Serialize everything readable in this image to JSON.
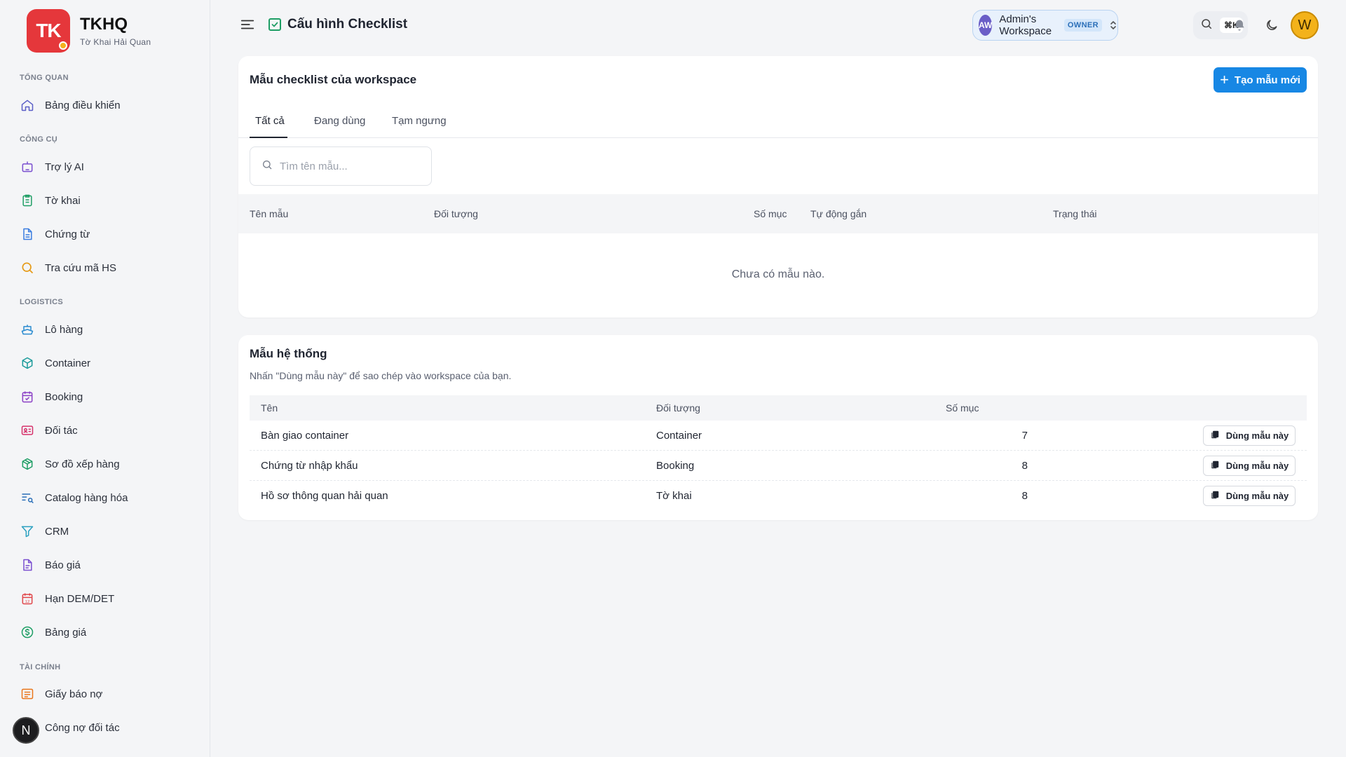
{
  "brand": {
    "logo_text": "TK",
    "name": "TKHQ",
    "subtitle": "Tờ Khai Hải Quan"
  },
  "sidebar": {
    "sections": [
      {
        "label": "TỔNG QUAN"
      },
      {
        "label": "CÔNG CỤ"
      },
      {
        "label": "LOGISTICS"
      },
      {
        "label": "TÀI CHÍNH"
      }
    ],
    "items": [
      {
        "label": "Bảng điều khiển",
        "icon": "home-icon"
      },
      {
        "label": "Trợ lý AI",
        "icon": "robot-icon"
      },
      {
        "label": "Tờ khai",
        "icon": "clipboard-icon"
      },
      {
        "label": "Chứng từ",
        "icon": "document-icon"
      },
      {
        "label": "Tra cứu mã HS",
        "icon": "search-icon"
      },
      {
        "label": "Lô hàng",
        "icon": "ship-icon"
      },
      {
        "label": "Container",
        "icon": "box-icon"
      },
      {
        "label": "Booking",
        "icon": "calendar-check-icon"
      },
      {
        "label": "Đối tác",
        "icon": "id-card-icon"
      },
      {
        "label": "Sơ đồ xếp hàng",
        "icon": "package-icon"
      },
      {
        "label": "Catalog hàng hóa",
        "icon": "list-search-icon"
      },
      {
        "label": "CRM",
        "icon": "funnel-icon"
      },
      {
        "label": "Báo giá",
        "icon": "file-text-icon"
      },
      {
        "label": "Hạn DEM/DET",
        "icon": "calendar-12-icon"
      },
      {
        "label": "Bảng giá",
        "icon": "dollar-circle-icon"
      },
      {
        "label": "Giấy báo nợ",
        "icon": "message-lines-icon"
      },
      {
        "label": "Công nợ đối tác",
        "icon": "wallet-icon"
      }
    ],
    "next_badge": "N"
  },
  "topbar": {
    "title": "Cấu hình Checklist",
    "workspace": {
      "avatar": "AW",
      "name": "Admin's Workspace",
      "role": "OWNER"
    },
    "shortcut": "⌘K",
    "user_initial": "W"
  },
  "workspace_templates": {
    "title": "Mẫu checklist của workspace",
    "create_label": "Tạo mẫu mới",
    "tabs": [
      {
        "label": "Tất cả"
      },
      {
        "label": "Đang dùng"
      },
      {
        "label": "Tạm ngưng"
      }
    ],
    "search_placeholder": "Tìm tên mẫu...",
    "columns": [
      "Tên mẫu",
      "Đối tượng",
      "Số mục",
      "Tự động gắn",
      "Trạng thái"
    ],
    "empty_message": "Chưa có mẫu nào."
  },
  "system_templates": {
    "title": "Mẫu hệ thống",
    "subtitle": "Nhấn \"Dùng mẫu này\" để sao chép vào workspace của bạn.",
    "columns": [
      "Tên",
      "Đối tượng",
      "Số mục"
    ],
    "use_label": "Dùng mẫu này",
    "rows": [
      {
        "name": "Bàn giao container",
        "target": "Container",
        "count": "7"
      },
      {
        "name": "Chứng từ nhập khẩu",
        "target": "Booking",
        "count": "8"
      },
      {
        "name": "Hồ sơ thông quan hải quan",
        "target": "Tờ khai",
        "count": "8"
      }
    ]
  }
}
